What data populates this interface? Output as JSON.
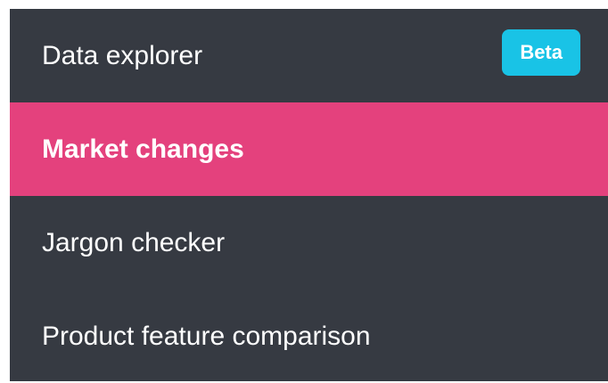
{
  "menu": {
    "items": [
      {
        "label": "Data explorer",
        "badge": "Beta",
        "active": false
      },
      {
        "label": "Market changes",
        "active": true
      },
      {
        "label": "Jargon checker",
        "active": false
      },
      {
        "label": "Product feature comparison",
        "active": false
      }
    ]
  },
  "colors": {
    "background": "#363a42",
    "active": "#e4417d",
    "badge": "#19c3e6",
    "text": "#ffffff"
  }
}
